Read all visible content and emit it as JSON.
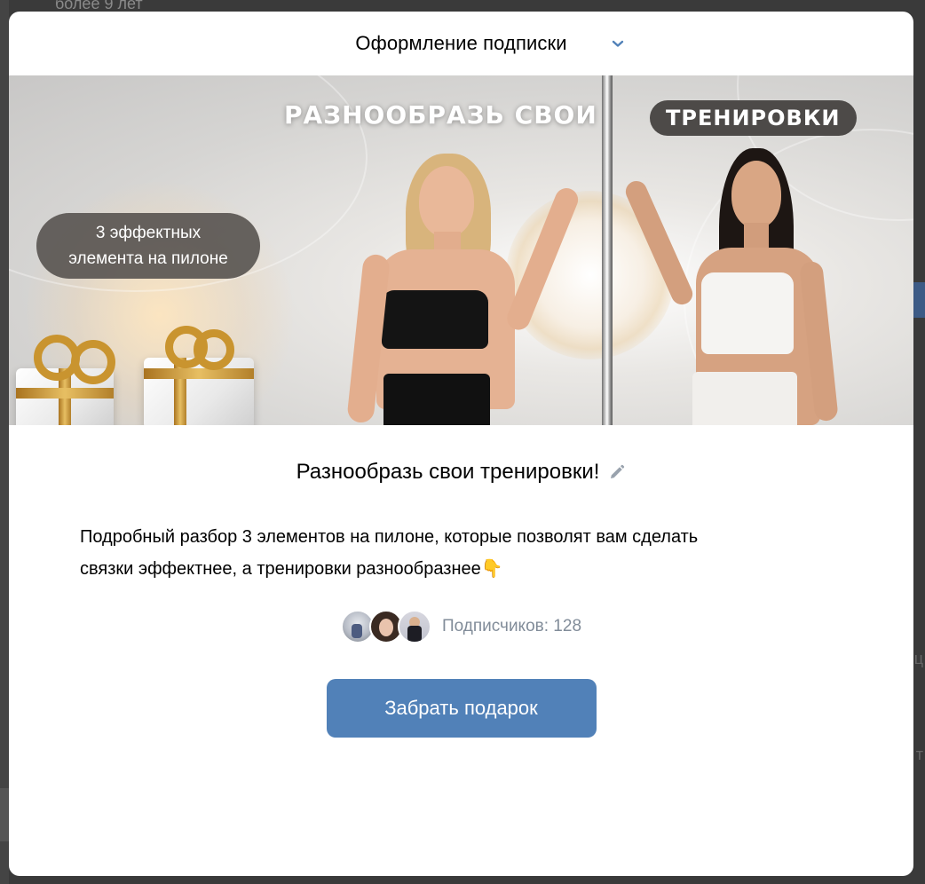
{
  "background_page": {
    "top_text": "более 9 лет"
  },
  "modal": {
    "title": "Оформление подписки",
    "header_icon": "chevron-down-icon"
  },
  "banner": {
    "headline_left": "РАЗНООБРАЗЬ СВОИ",
    "headline_right": "ТРЕНИРОВКИ",
    "badge_line1": "3 эффектных",
    "badge_line2": "элемента на пилоне"
  },
  "content": {
    "title": "Разнообразь свои тренировки!",
    "title_icon": "edit-icon",
    "description_line1": "Подробный разбор 3 элементов на пилоне, которые позволят вам сделать",
    "description_line2": "связки эффектнее, а тренировки разнообразнее👇",
    "subscribers_label": "Подписчиков: 128",
    "cta_label": "Забрать подарок"
  },
  "colors": {
    "accent": "#5181b8",
    "chevron": "#5181b8",
    "muted_text": "#818c99",
    "badge_bg": "#5a5652"
  }
}
